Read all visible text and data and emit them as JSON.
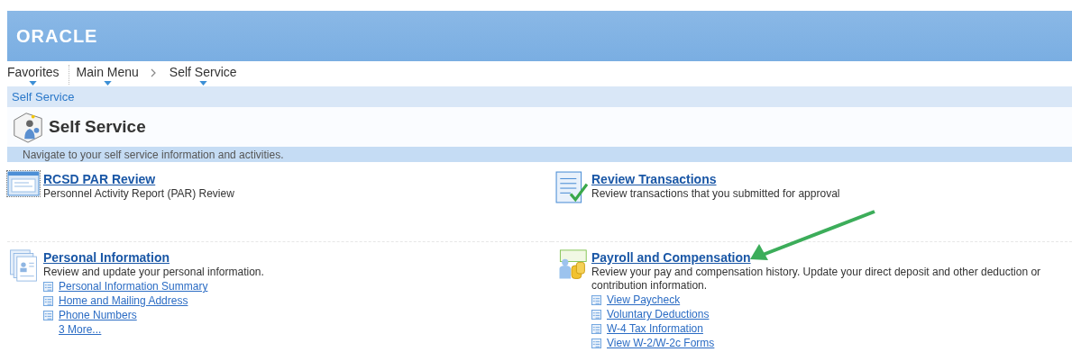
{
  "header": {
    "logo": "ORACLE"
  },
  "nav": [
    {
      "label": "Favorites",
      "kind": "menu"
    },
    {
      "label": "Main Menu",
      "kind": "menu"
    },
    {
      "label": "Self Service",
      "kind": "menu"
    }
  ],
  "breadcrumb": "Self Service",
  "page": {
    "title": "Self Service",
    "description": "Navigate to your self service information and activities."
  },
  "tiles": [
    {
      "title": "RCSD PAR Review",
      "description": "Personnel Activity Report (PAR) Review"
    },
    {
      "title": "Review Transactions",
      "description": "Review transactions that you submitted for approval"
    },
    {
      "title": "Personal Information",
      "description": "Review and update your personal information.",
      "links": [
        {
          "label": "Personal Information Summary",
          "kind": "page"
        },
        {
          "label": "Home and Mailing Address",
          "kind": "page"
        },
        {
          "label": "Phone Numbers",
          "kind": "page"
        },
        {
          "label": "3 More...",
          "kind": "more"
        }
      ]
    },
    {
      "title": "Payroll and Compensation",
      "description": "Review your pay and compensation history. Update your direct deposit and other deduction or contribution information.",
      "links": [
        {
          "label": "View Paycheck",
          "kind": "page"
        },
        {
          "label": "Voluntary Deductions",
          "kind": "page"
        },
        {
          "label": "W-4 Tax Information",
          "kind": "page"
        },
        {
          "label": "View W-2/W-2c Forms",
          "kind": "page"
        }
      ]
    }
  ]
}
